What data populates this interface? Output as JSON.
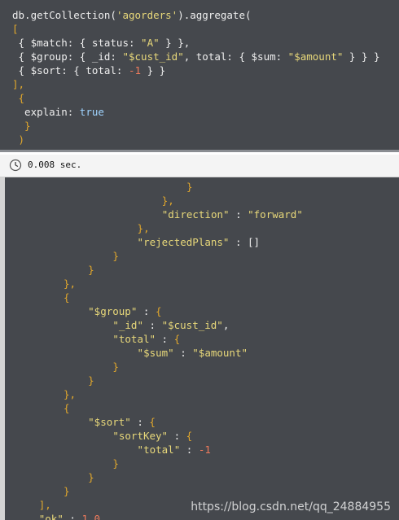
{
  "colors": {
    "editor_bg": "#45484d",
    "default_text": "#eeeeee",
    "string": "#e8d87a",
    "number": "#f07b5c",
    "bracket": "#e2a82c",
    "keyword": "#9fd4ff"
  },
  "editor": {
    "lines": [
      [
        {
          "t": "db.getCollection(",
          "c": "default"
        },
        {
          "t": "'agorders'",
          "c": "string"
        },
        {
          "t": ").aggregate(",
          "c": "default"
        }
      ],
      [
        {
          "t": "[",
          "c": "bracket"
        }
      ],
      [
        {
          "t": " { $match: { status: ",
          "c": "default"
        },
        {
          "t": "\"A\"",
          "c": "string"
        },
        {
          "t": " } },",
          "c": "default"
        }
      ],
      [
        {
          "t": " { $group: { _id: ",
          "c": "default"
        },
        {
          "t": "\"$cust_id\"",
          "c": "string"
        },
        {
          "t": ", total: { $sum: ",
          "c": "default"
        },
        {
          "t": "\"$amount\"",
          "c": "string"
        },
        {
          "t": " } } }",
          "c": "default"
        }
      ],
      [
        {
          "t": " { $sort: { total: ",
          "c": "default"
        },
        {
          "t": "-1",
          "c": "number"
        },
        {
          "t": " } }",
          "c": "default"
        }
      ],
      [
        {
          "t": "],",
          "c": "bracket"
        }
      ],
      [
        {
          "t": " {",
          "c": "bracket"
        }
      ],
      [
        {
          "t": "  explain: ",
          "c": "default"
        },
        {
          "t": "true",
          "c": "keyword"
        }
      ],
      [
        {
          "t": "  }",
          "c": "bracket"
        }
      ],
      [
        {
          "t": " )",
          "c": "bracket"
        }
      ]
    ]
  },
  "status": {
    "icon": "clock-icon",
    "exec_time": "0.008 sec."
  },
  "result": {
    "lines": [
      {
        "indent": 29,
        "tokens": [
          {
            "t": "}",
            "c": "bracket"
          }
        ]
      },
      {
        "indent": 25,
        "tokens": [
          {
            "t": "},",
            "c": "bracket"
          }
        ]
      },
      {
        "indent": 25,
        "tokens": [
          {
            "t": "\"direction\"",
            "c": "string"
          },
          {
            "t": " : ",
            "c": "default"
          },
          {
            "t": "\"forward\"",
            "c": "string"
          }
        ]
      },
      {
        "indent": 21,
        "tokens": [
          {
            "t": "},",
            "c": "bracket"
          }
        ]
      },
      {
        "indent": 21,
        "tokens": [
          {
            "t": "\"rejectedPlans\"",
            "c": "string"
          },
          {
            "t": " : ",
            "c": "default"
          },
          {
            "t": "[]",
            "c": "default"
          }
        ]
      },
      {
        "indent": 17,
        "tokens": [
          {
            "t": "}",
            "c": "bracket"
          }
        ]
      },
      {
        "indent": 13,
        "tokens": [
          {
            "t": "}",
            "c": "bracket"
          }
        ]
      },
      {
        "indent": 9,
        "tokens": [
          {
            "t": "},",
            "c": "bracket"
          }
        ]
      },
      {
        "indent": 9,
        "tokens": [
          {
            "t": "{",
            "c": "bracket"
          }
        ]
      },
      {
        "indent": 13,
        "tokens": [
          {
            "t": "\"$group\"",
            "c": "string"
          },
          {
            "t": " : ",
            "c": "default"
          },
          {
            "t": "{",
            "c": "bracket"
          }
        ]
      },
      {
        "indent": 17,
        "tokens": [
          {
            "t": "\"_id\"",
            "c": "string"
          },
          {
            "t": " : ",
            "c": "default"
          },
          {
            "t": "\"$cust_id\"",
            "c": "string"
          },
          {
            "t": ",",
            "c": "default"
          }
        ]
      },
      {
        "indent": 17,
        "tokens": [
          {
            "t": "\"total\"",
            "c": "string"
          },
          {
            "t": " : ",
            "c": "default"
          },
          {
            "t": "{",
            "c": "bracket"
          }
        ]
      },
      {
        "indent": 21,
        "tokens": [
          {
            "t": "\"$sum\"",
            "c": "string"
          },
          {
            "t": " : ",
            "c": "default"
          },
          {
            "t": "\"$amount\"",
            "c": "string"
          }
        ]
      },
      {
        "indent": 17,
        "tokens": [
          {
            "t": "}",
            "c": "bracket"
          }
        ]
      },
      {
        "indent": 13,
        "tokens": [
          {
            "t": "}",
            "c": "bracket"
          }
        ]
      },
      {
        "indent": 9,
        "tokens": [
          {
            "t": "},",
            "c": "bracket"
          }
        ]
      },
      {
        "indent": 9,
        "tokens": [
          {
            "t": "{",
            "c": "bracket"
          }
        ]
      },
      {
        "indent": 13,
        "tokens": [
          {
            "t": "\"$sort\"",
            "c": "string"
          },
          {
            "t": " : ",
            "c": "default"
          },
          {
            "t": "{",
            "c": "bracket"
          }
        ]
      },
      {
        "indent": 17,
        "tokens": [
          {
            "t": "\"sortKey\"",
            "c": "string"
          },
          {
            "t": " : ",
            "c": "default"
          },
          {
            "t": "{",
            "c": "bracket"
          }
        ]
      },
      {
        "indent": 21,
        "tokens": [
          {
            "t": "\"total\"",
            "c": "string"
          },
          {
            "t": " : ",
            "c": "default"
          },
          {
            "t": "-1",
            "c": "number"
          }
        ]
      },
      {
        "indent": 17,
        "tokens": [
          {
            "t": "}",
            "c": "bracket"
          }
        ]
      },
      {
        "indent": 13,
        "tokens": [
          {
            "t": "}",
            "c": "bracket"
          }
        ]
      },
      {
        "indent": 9,
        "tokens": [
          {
            "t": "}",
            "c": "bracket"
          }
        ]
      },
      {
        "indent": 5,
        "tokens": [
          {
            "t": "],",
            "c": "bracket"
          }
        ]
      },
      {
        "indent": 5,
        "tokens": [
          {
            "t": "\"ok\"",
            "c": "string"
          },
          {
            "t": " : ",
            "c": "default"
          },
          {
            "t": "1.0",
            "c": "number"
          }
        ]
      }
    ]
  },
  "watermark": "https://blog.csdn.net/qq_24884955"
}
